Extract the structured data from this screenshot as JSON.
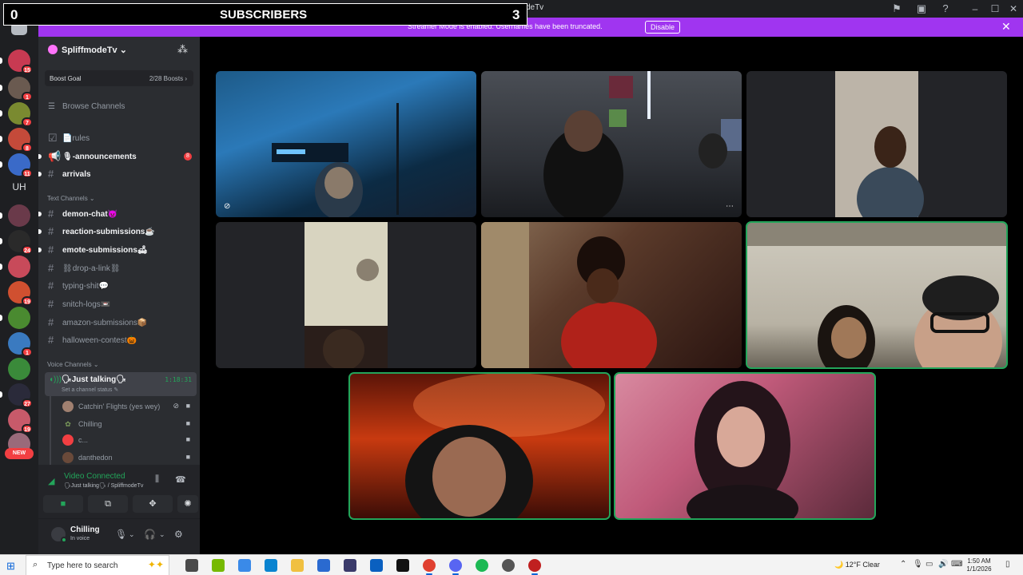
{
  "overlay": {
    "left_count": "0",
    "label": "SUBSCRIBERS",
    "right_count": "3"
  },
  "window": {
    "title": "SpliffmodeTv"
  },
  "banner": {
    "message": "Streamer Mode is enabled. Usernames have been truncated.",
    "button": "Disable"
  },
  "server_rail": {
    "badges": [
      "15",
      "1",
      "7",
      "8",
      "11",
      "24",
      "19",
      "1",
      "27",
      "19"
    ],
    "text_server": "UH",
    "new_label": "NEW"
  },
  "server": {
    "name": "SpliffmodeTv",
    "boost_goal": "Boost Goal",
    "boost_progress": "2/28 Boosts",
    "browse": "Browse Channels"
  },
  "channels": {
    "top": [
      {
        "name": "📄rules",
        "unread": false
      },
      {
        "name": "🎙-announcements",
        "unread": true,
        "mention": "8"
      },
      {
        "name": "arrivals",
        "unread": true
      }
    ],
    "text_category": "Text Channels",
    "text": [
      {
        "name": "demon-chat👿",
        "unread": true
      },
      {
        "name": "reaction-submissions☕",
        "unread": true
      },
      {
        "name": "emote-submissions🛋",
        "unread": true
      },
      {
        "name": "⛓drop-a-link⛓",
        "unread": false
      },
      {
        "name": "typing-shit💬",
        "unread": false
      },
      {
        "name": "snitch-logs📼",
        "unread": false
      },
      {
        "name": "amazon-submissions📦",
        "unread": false
      },
      {
        "name": "halloween-contest🎃",
        "unread": false
      }
    ],
    "voice_category": "Voice Channels",
    "voice": {
      "name": "🗣Just talking🗣",
      "timer": "1:18:31",
      "status": "Set a channel status ✎"
    },
    "voice_users": [
      "Catchin' Flights (yes wey)",
      "Chilling",
      "c...",
      "danthedon"
    ]
  },
  "voice_panel": {
    "title": "Video Connected",
    "subtitle": "🗣Just talking🗣 / SpliffmodeTv"
  },
  "user": {
    "name": "Chilling",
    "status": "In voice"
  },
  "taskbar": {
    "search_placeholder": "Type here to search",
    "weather": "12°F  Clear",
    "time": "1:50 AM",
    "date": "1/1/2026"
  },
  "colors": {
    "accent_green": "#23a55a",
    "banner_purple": "#a035f0",
    "mention_red": "#f23f42"
  }
}
